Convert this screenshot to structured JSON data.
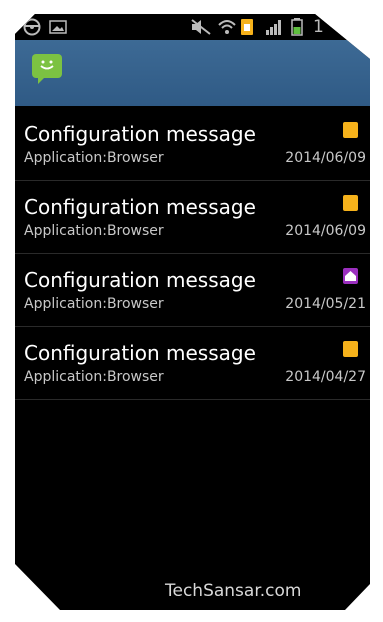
{
  "status_bar": {
    "icons": [
      "steering-wheel-icon",
      "gallery-icon",
      "mute-icon",
      "wifi-icon",
      "sim-icon",
      "signal-icon",
      "battery-icon"
    ],
    "time_partial": "1"
  },
  "action_bar": {
    "app_icon": "messaging-icon"
  },
  "messages": [
    {
      "title": "Configuration message",
      "subtitle": "Application:Browser",
      "date": "2014/06/09",
      "icon": "browser-icon"
    },
    {
      "title": "Configuration message",
      "subtitle": "Application:Browser",
      "date": "2014/06/09",
      "icon": "browser-icon"
    },
    {
      "title": "Configuration message",
      "subtitle": "Application:Browser",
      "date": "2014/05/21",
      "icon": "home-icon"
    },
    {
      "title": "Configuration message",
      "subtitle": "Application:Browser",
      "date": "2014/04/27",
      "icon": "browser-icon"
    }
  ],
  "watermark": "TechSansar.com",
  "colors": {
    "action_bar": "#34628f",
    "browser_icon": "#f6b21b",
    "home_icon": "#9b2fbf",
    "app_icon": "#7cc242"
  }
}
